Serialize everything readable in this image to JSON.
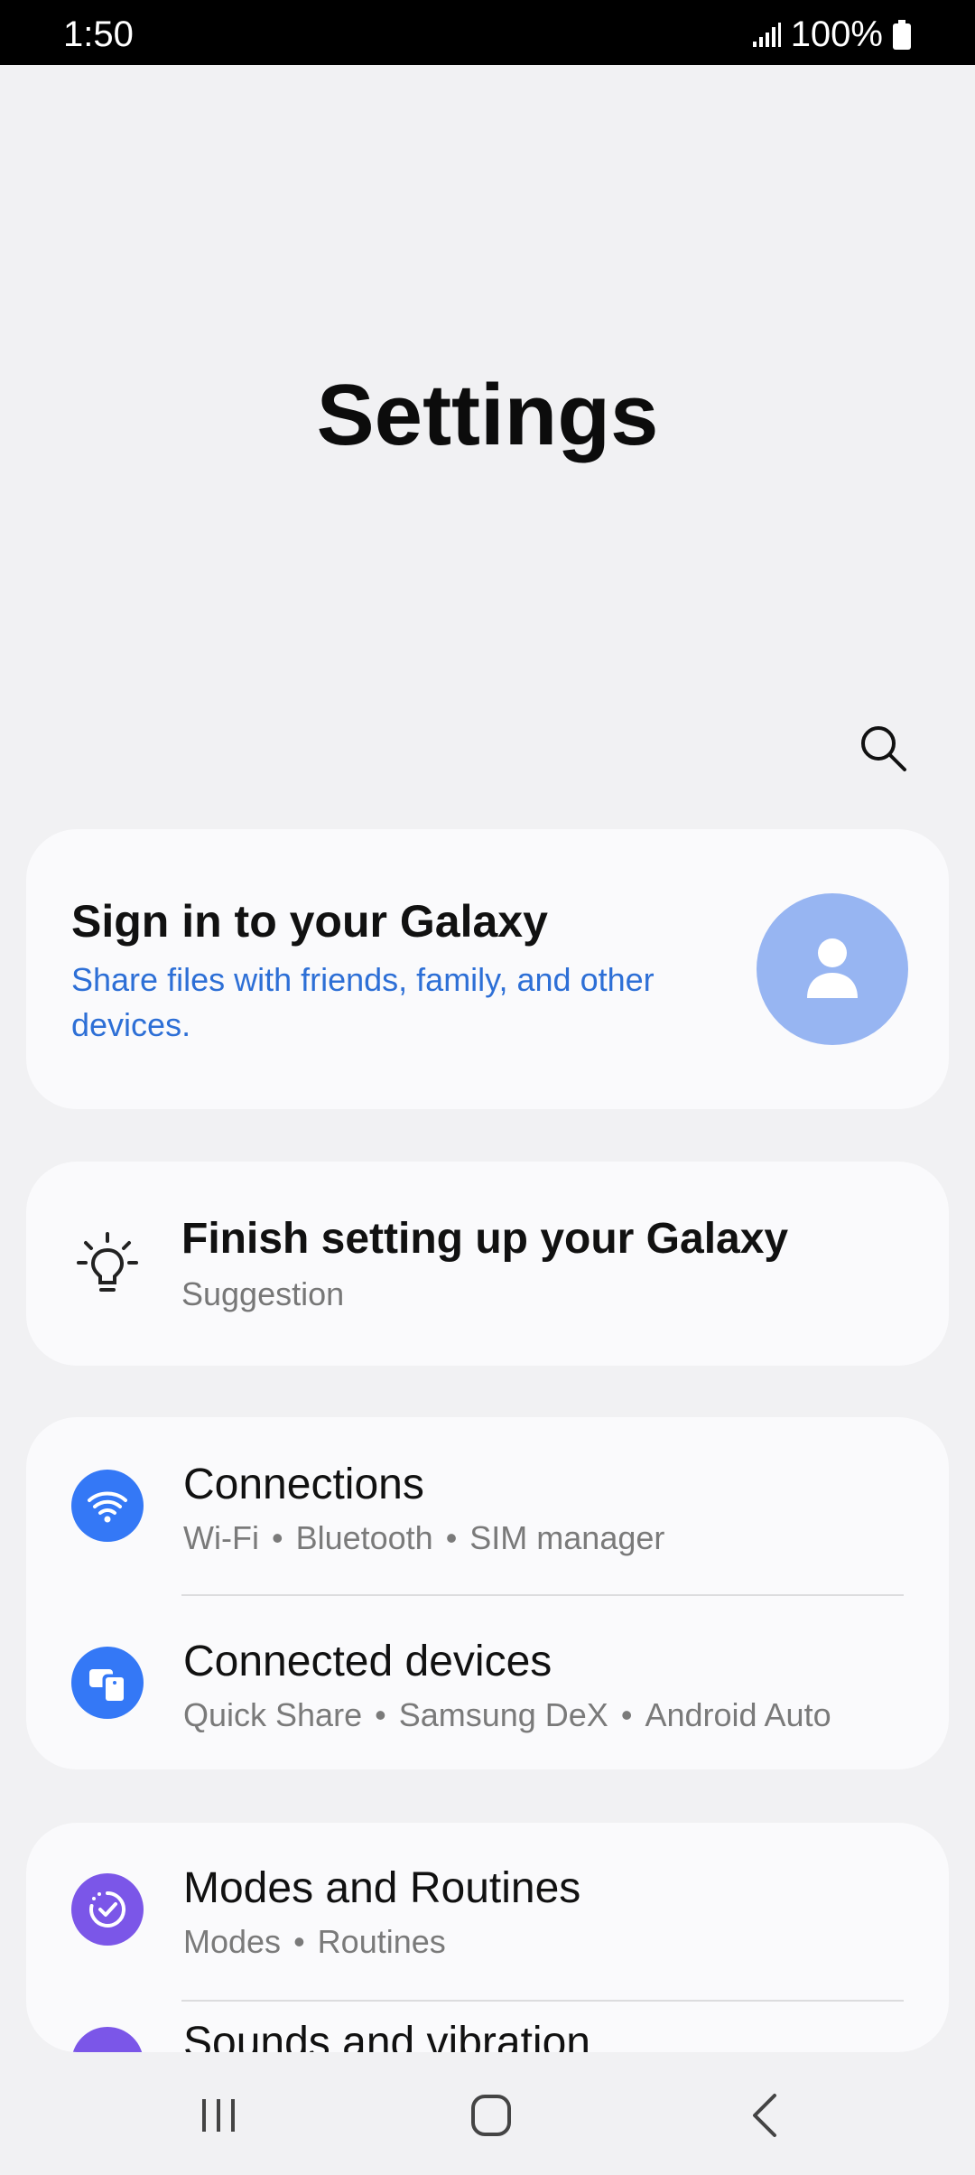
{
  "status_bar": {
    "time": "1:50",
    "battery": "100%"
  },
  "page": {
    "title": "Settings"
  },
  "signin": {
    "title": "Sign in to your Galaxy",
    "description": "Share files with friends, family, and other devices."
  },
  "suggestion": {
    "title": "Finish setting up your Galaxy",
    "subtitle": "Suggestion"
  },
  "menu": [
    {
      "title": "Connections",
      "subtitle": [
        "Wi-Fi",
        "Bluetooth",
        "SIM manager"
      ],
      "icon": "wifi-icon",
      "color": "#3478f6"
    },
    {
      "title": "Connected devices",
      "subtitle": [
        "Quick Share",
        "Samsung DeX",
        "Android Auto"
      ],
      "icon": "devices-icon",
      "color": "#3478f6"
    },
    {
      "title": "Modes and Routines",
      "subtitle": [
        "Modes",
        "Routines"
      ],
      "icon": "routines-icon",
      "color": "#7b56e8"
    },
    {
      "title": "Sounds and vibration",
      "icon": "sound-icon",
      "color": "#7b56e8"
    }
  ],
  "colors": {
    "accent_blue": "#3478f6",
    "accent_purple": "#7b56e8",
    "link_blue": "#2d6fd6",
    "avatar": "#97b5f2"
  }
}
